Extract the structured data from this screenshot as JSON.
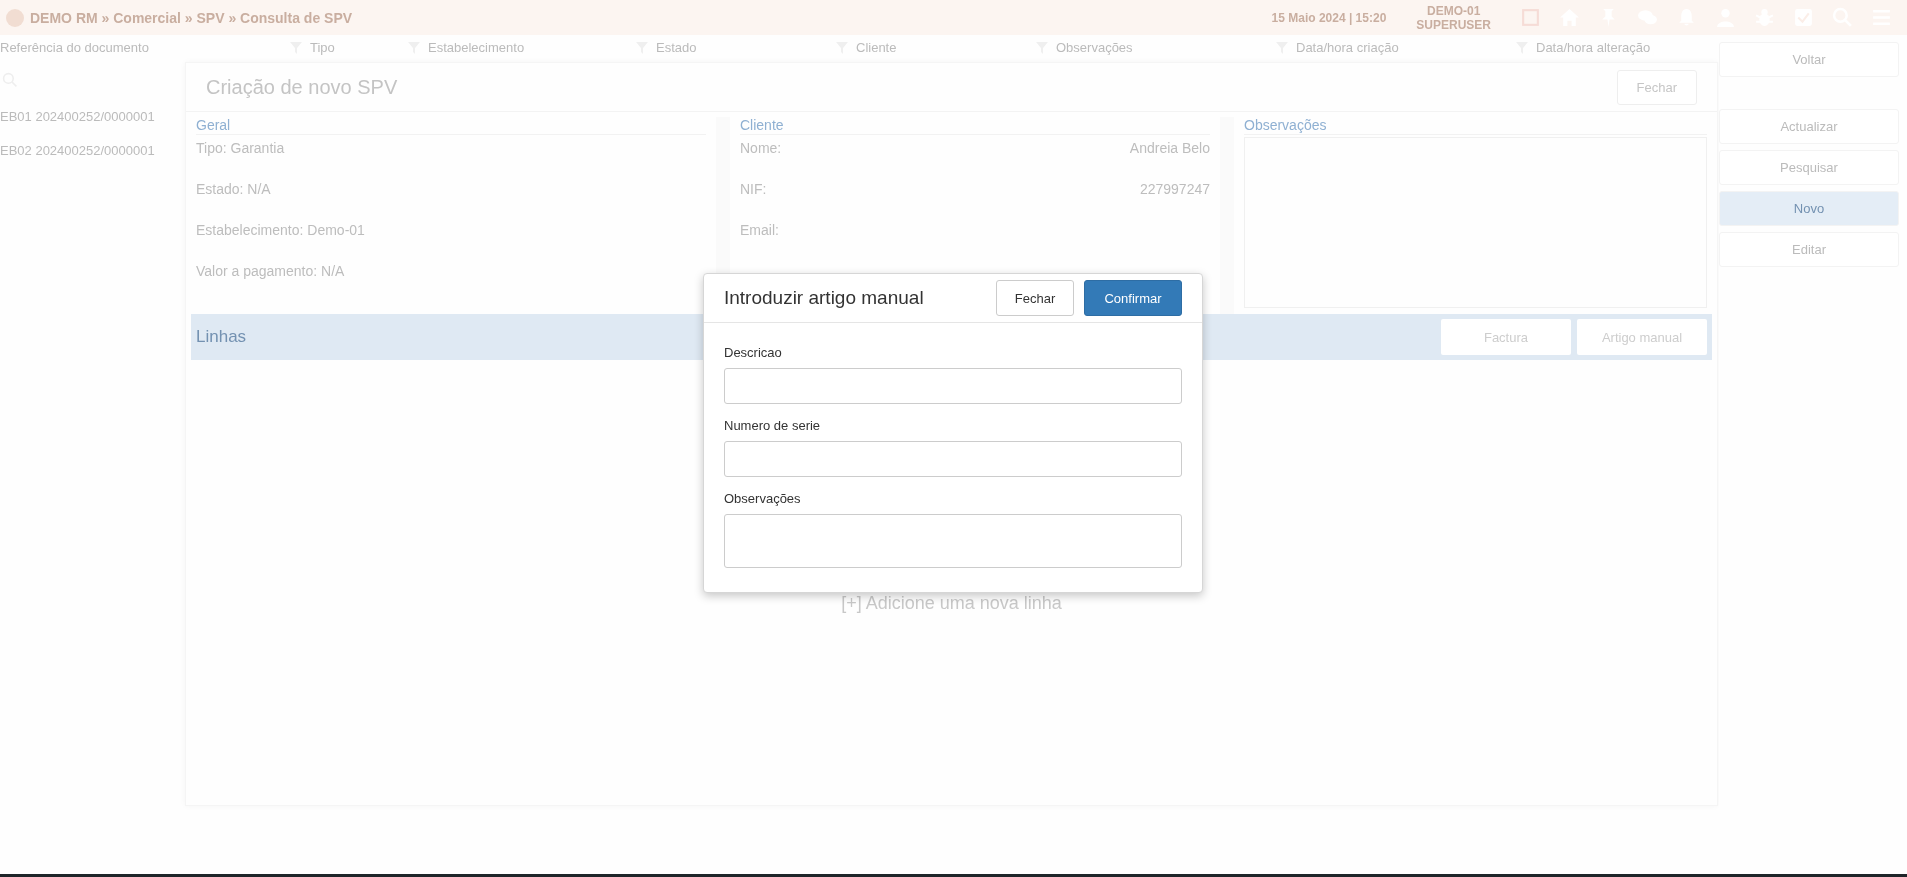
{
  "top_bar": {
    "breadcrumb": "DEMO RM » Comercial » SPV » Consulta de SPV",
    "date": "15 Maio 2024 | 15:20",
    "establishment": "DEMO-01",
    "user": "SUPERUSER"
  },
  "table": {
    "columns": [
      {
        "label": "Referência do documento"
      },
      {
        "label": "Tipo"
      },
      {
        "label": "Estabelecimento"
      },
      {
        "label": "Estado"
      },
      {
        "label": "Cliente"
      },
      {
        "label": "Observações"
      },
      {
        "label": "Data/hora criação"
      },
      {
        "label": "Data/hora alteração"
      }
    ],
    "rows": [
      {
        "reference": "EB01 202400252/0000001"
      },
      {
        "reference": "EB02 202400252/0000001"
      }
    ]
  },
  "side_actions": [
    {
      "label": "Voltar",
      "selected": false
    },
    {
      "label": "Actualizar",
      "selected": false
    },
    {
      "label": "Pesquisar",
      "selected": false
    },
    {
      "label": "Novo",
      "selected": true
    },
    {
      "label": "Editar",
      "selected": false
    }
  ],
  "panel": {
    "title": "Criação de novo SPV",
    "close_label": "Fechar",
    "geral": {
      "title": "Geral",
      "fields": [
        "Tipo: Garantia",
        "Estado: N/A",
        "Estabelecimento: Demo-01",
        "Valor a pagamento: N/A"
      ]
    },
    "cliente": {
      "title": "Cliente",
      "fields": [
        {
          "label": "Nome:",
          "value": "Andreia Belo"
        },
        {
          "label": "NIF:",
          "value": "227997247"
        },
        {
          "label": "Email:"
        }
      ]
    },
    "observacoes": {
      "title": "Observações"
    },
    "lines": {
      "title": "Linhas",
      "buttons": [
        "Factura",
        "Artigo manual"
      ],
      "empty_text": "[+] Adicione uma nova linha"
    }
  },
  "dialog": {
    "title": "Introduzir artigo manual",
    "buttons": [
      {
        "label": "Fechar",
        "kind": "default"
      },
      {
        "label": "Confirmar",
        "kind": "primary"
      }
    ],
    "fields": [
      {
        "label": "Descricao",
        "kind": "input"
      },
      {
        "label": "Numero de serie",
        "kind": "input"
      },
      {
        "label": "Observações",
        "kind": "textarea"
      }
    ]
  }
}
